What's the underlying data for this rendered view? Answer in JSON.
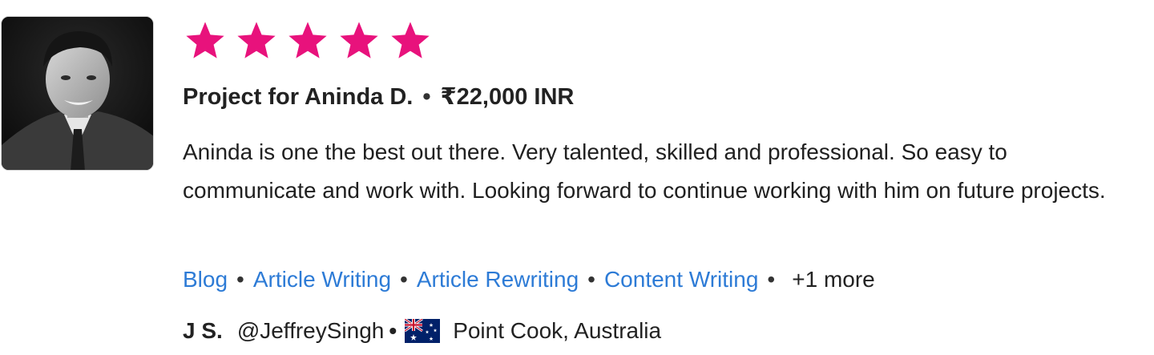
{
  "rating": {
    "stars": 5,
    "max": 5,
    "color": "#e8127c"
  },
  "project": {
    "title": "Project for Aninda D.",
    "separator": "•",
    "amount": "₹22,000 INR"
  },
  "review": {
    "text": "Aninda is one the best out there. Very talented, skilled and professional. So easy to communicate and work with. Looking forward to continue working with him on future projects."
  },
  "skills": {
    "items": [
      "Blog",
      "Article Writing",
      "Article Rewriting",
      "Content Writing"
    ],
    "separator": "•",
    "more": "+1 more",
    "link_color": "#2d7bd6"
  },
  "author": {
    "name": "J S.",
    "handle": "@JeffreySingh",
    "separator": "•",
    "flag": "australia-flag-icon",
    "location": "Point Cook, Australia"
  }
}
